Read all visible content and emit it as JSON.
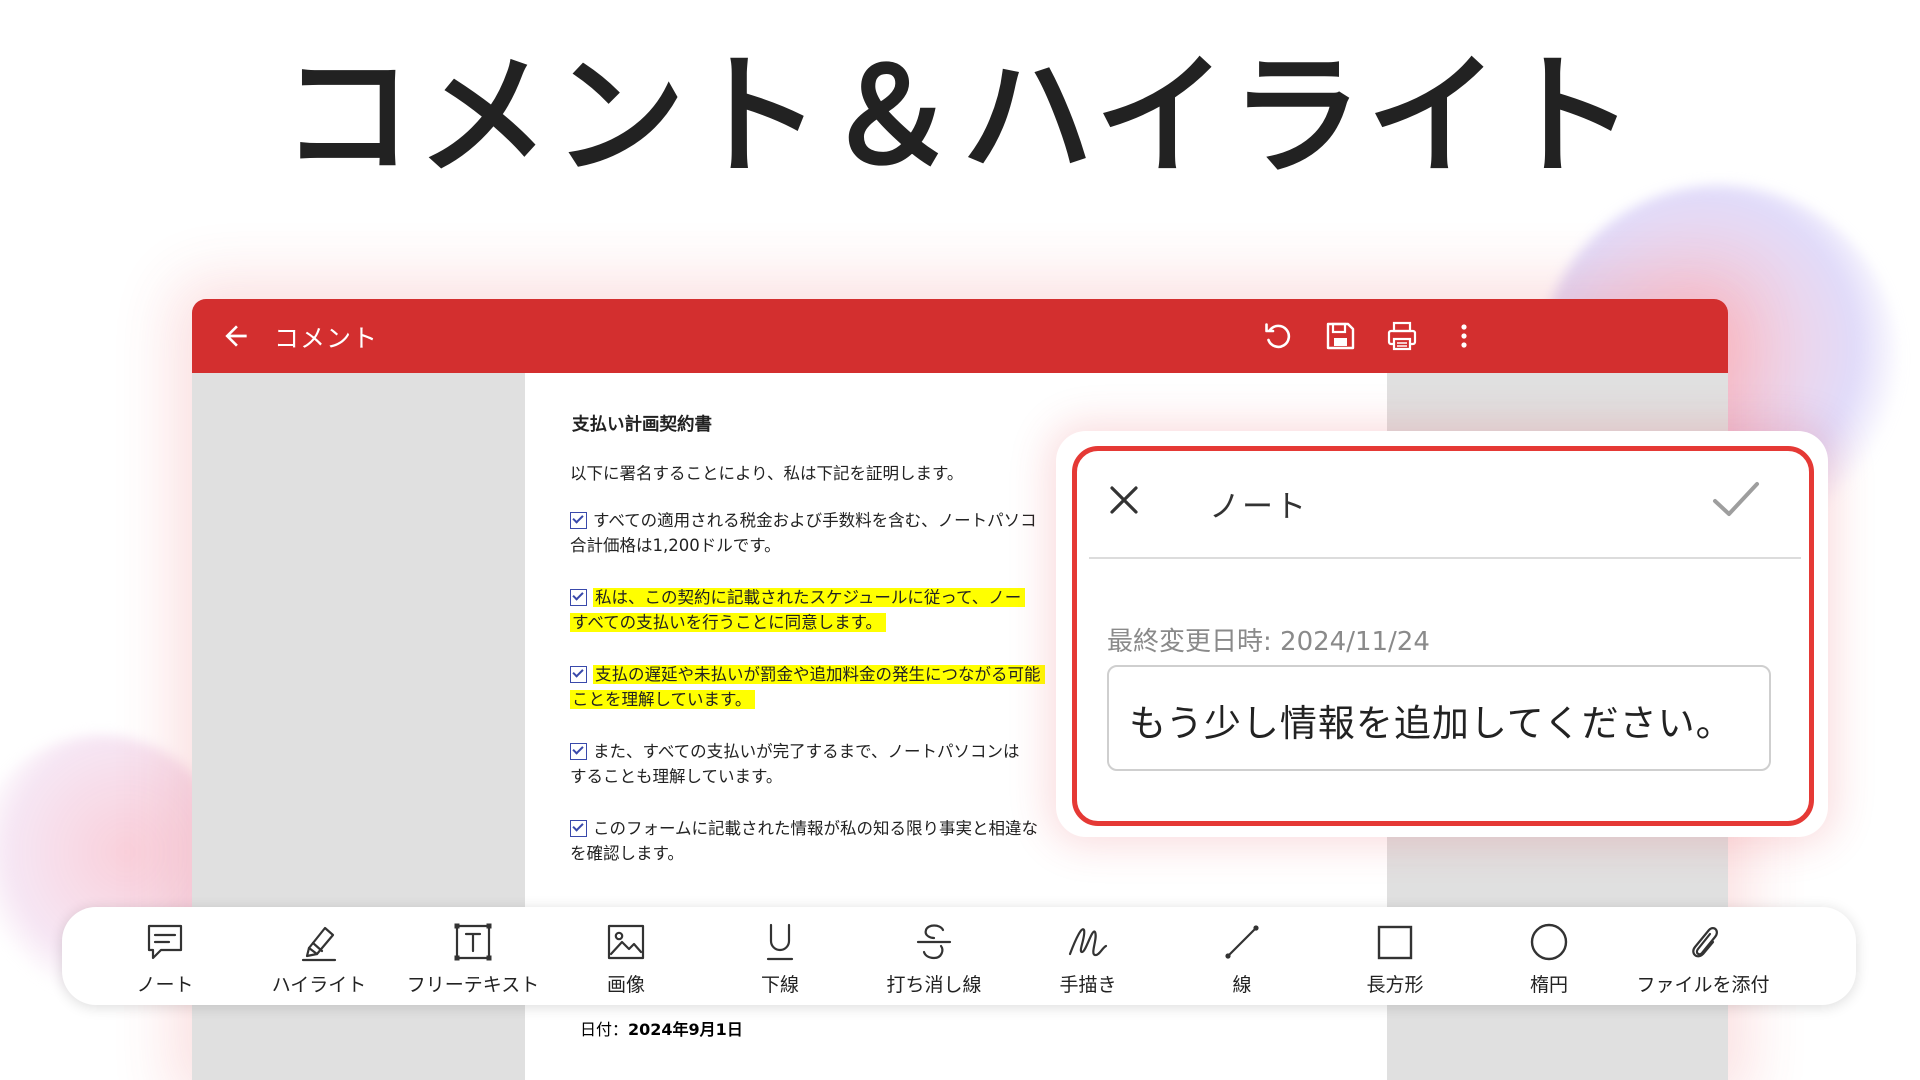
{
  "hero_title": "コメント＆ハイライト",
  "appbar": {
    "title": "コメント",
    "color": "#d32f2f",
    "icons": [
      "back-arrow-icon",
      "undo-icon",
      "save-icon",
      "print-icon",
      "more-vert-icon"
    ]
  },
  "document": {
    "title": "支払い計画契約書",
    "intro": "以下に署名することにより、私は下記を証明します。",
    "items": [
      {
        "line1": "すべての適用される税金および手数料を含む、ノートパソコ",
        "line2": "合計価格は1,200ドルです。",
        "highlight": false
      },
      {
        "line1": "私は、この契約に記載されたスケジュールに従って、ノー",
        "line2": "すべての支払いを行うことに同意します。",
        "highlight": true
      },
      {
        "line1": "支払の遅延や未払いが罰金や追加料金の発生につながる可能",
        "line2": "ことを理解しています。",
        "highlight": true
      },
      {
        "line1": "また、すべての支払いが完了するまで、ノートパソコンは",
        "line2": "することも理解しています。",
        "highlight": false
      },
      {
        "line1": "このフォームに記載された情報が私の知る限り事実と相違な",
        "line2": "を確認します。",
        "highlight": false
      }
    ],
    "date_label": "日付：",
    "date_value": "2024年9月1日",
    "highlight_color": "#ffff00"
  },
  "note_dialog": {
    "title": "ノート",
    "modified": "最終変更日時: 2024/11/24",
    "content": "もう少し情報を追加してください。",
    "border_color": "#e53935"
  },
  "toolbar": {
    "tools": [
      {
        "label": "ノート",
        "icon": "note-icon"
      },
      {
        "label": "ハイライト",
        "icon": "highlighter-icon"
      },
      {
        "label": "フリーテキスト",
        "icon": "free-text-icon"
      },
      {
        "label": "画像",
        "icon": "image-icon"
      },
      {
        "label": "下線",
        "icon": "underline-icon"
      },
      {
        "label": "打ち消し線",
        "icon": "strikethrough-icon"
      },
      {
        "label": "手描き",
        "icon": "freehand-icon"
      },
      {
        "label": "線",
        "icon": "line-icon"
      },
      {
        "label": "長方形",
        "icon": "rectangle-icon"
      },
      {
        "label": "楕円",
        "icon": "ellipse-icon"
      },
      {
        "label": "ファイルを添付",
        "icon": "attach-file-icon"
      }
    ]
  }
}
